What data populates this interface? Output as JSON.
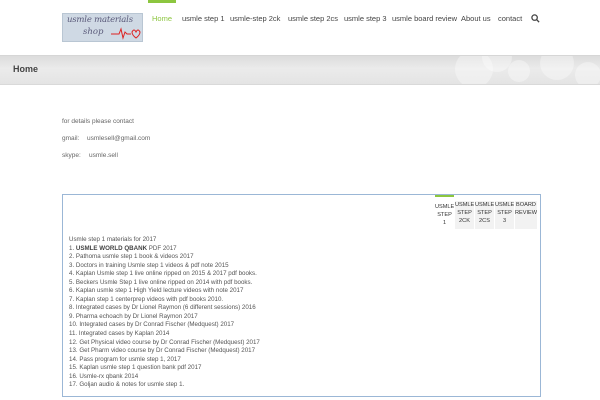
{
  "logo": {
    "line1": "usmle materials",
    "line2": "shop"
  },
  "nav": [
    {
      "label": "Home"
    },
    {
      "label": "usmle step 1"
    },
    {
      "label": "usmle-step 2ck"
    },
    {
      "label": "usmle step 2cs"
    },
    {
      "label": "usmle step 3"
    },
    {
      "label": "usmle board review"
    },
    {
      "label": "About us"
    },
    {
      "label": "contact"
    }
  ],
  "accent_color": "#8cc63f",
  "search_icon": "search-icon",
  "page_title": "Home",
  "contact": {
    "intro": "for details please contact",
    "gmail_label": "gmail:",
    "gmail_value": "usmlesell@gmail.com",
    "skype_label": "skype:",
    "skype_value": "usmle.sell"
  },
  "tabs": [
    {
      "lines": [
        "USMLE",
        "STEP",
        "1"
      ]
    },
    {
      "lines": [
        "USMLE",
        "STEP",
        "2CK"
      ]
    },
    {
      "lines": [
        "USMLE",
        "STEP",
        "2CS"
      ]
    },
    {
      "lines": [
        "USMLE",
        "STEP",
        "3"
      ]
    },
    {
      "lines": [
        "BOARD",
        "REVIEW",
        ""
      ]
    }
  ],
  "materials": {
    "title": "Usmle step 1 materials for 2017",
    "items": [
      {
        "prefix": "1. ",
        "bold": "USMLE WORLD QBANK",
        "text": " PDF 2017"
      },
      {
        "prefix": "2. ",
        "bold": "",
        "text": "Pathoma usmle step 1 book & videos 2017"
      },
      {
        "prefix": "3. ",
        "bold": "",
        "text": "Doctors in training Usmle step 1 videos & pdf note 2015"
      },
      {
        "prefix": "4. ",
        "bold": "",
        "text": "Kaplan Usmle step 1 live online ripped on 2015 & 2017 pdf books."
      },
      {
        "prefix": "5. ",
        "bold": "",
        "text": "Beckers Usmle Step 1 live online ripped on 2014 with pdf books."
      },
      {
        "prefix": "6. ",
        "bold": "",
        "text": "Kaplan usmle step 1 High Yield lecture videos with note 2017"
      },
      {
        "prefix": "7. ",
        "bold": "",
        "text": "Kaplan step 1 centerprep videos with pdf books 2010."
      },
      {
        "prefix": "8. ",
        "bold": "",
        "text": "Integrated cases by Dr Lionel Raymon (6 different sessions) 2016"
      },
      {
        "prefix": "9. ",
        "bold": "",
        "text": "Pharma echoach by Dr Lionel Raymon 2017"
      },
      {
        "prefix": "10. ",
        "bold": "",
        "text": "Integrated cases by Dr Conrad Fischer (Medquest) 2017"
      },
      {
        "prefix": "11. ",
        "bold": "",
        "text": "Integrated cases by Kaplan 2014"
      },
      {
        "prefix": "12. ",
        "bold": "",
        "text": "Get Physical video course by Dr Conrad Fischer (Medquest) 2017"
      },
      {
        "prefix": "13. ",
        "bold": "",
        "text": "Get Pharm video course by Dr Conrad Fischer (Medquest) 2017"
      },
      {
        "prefix": "14. ",
        "bold": "",
        "text": "Pass program for usmle step 1, 2017"
      },
      {
        "prefix": "15. ",
        "bold": "",
        "text": "Kaplan usmle step 1 question bank pdf 2017"
      },
      {
        "prefix": "16. ",
        "bold": "",
        "text": "Usmle-rx qbank 2014"
      },
      {
        "prefix": "17. ",
        "bold": "",
        "text": "Goljan audio & notes for usmle step 1."
      }
    ]
  }
}
